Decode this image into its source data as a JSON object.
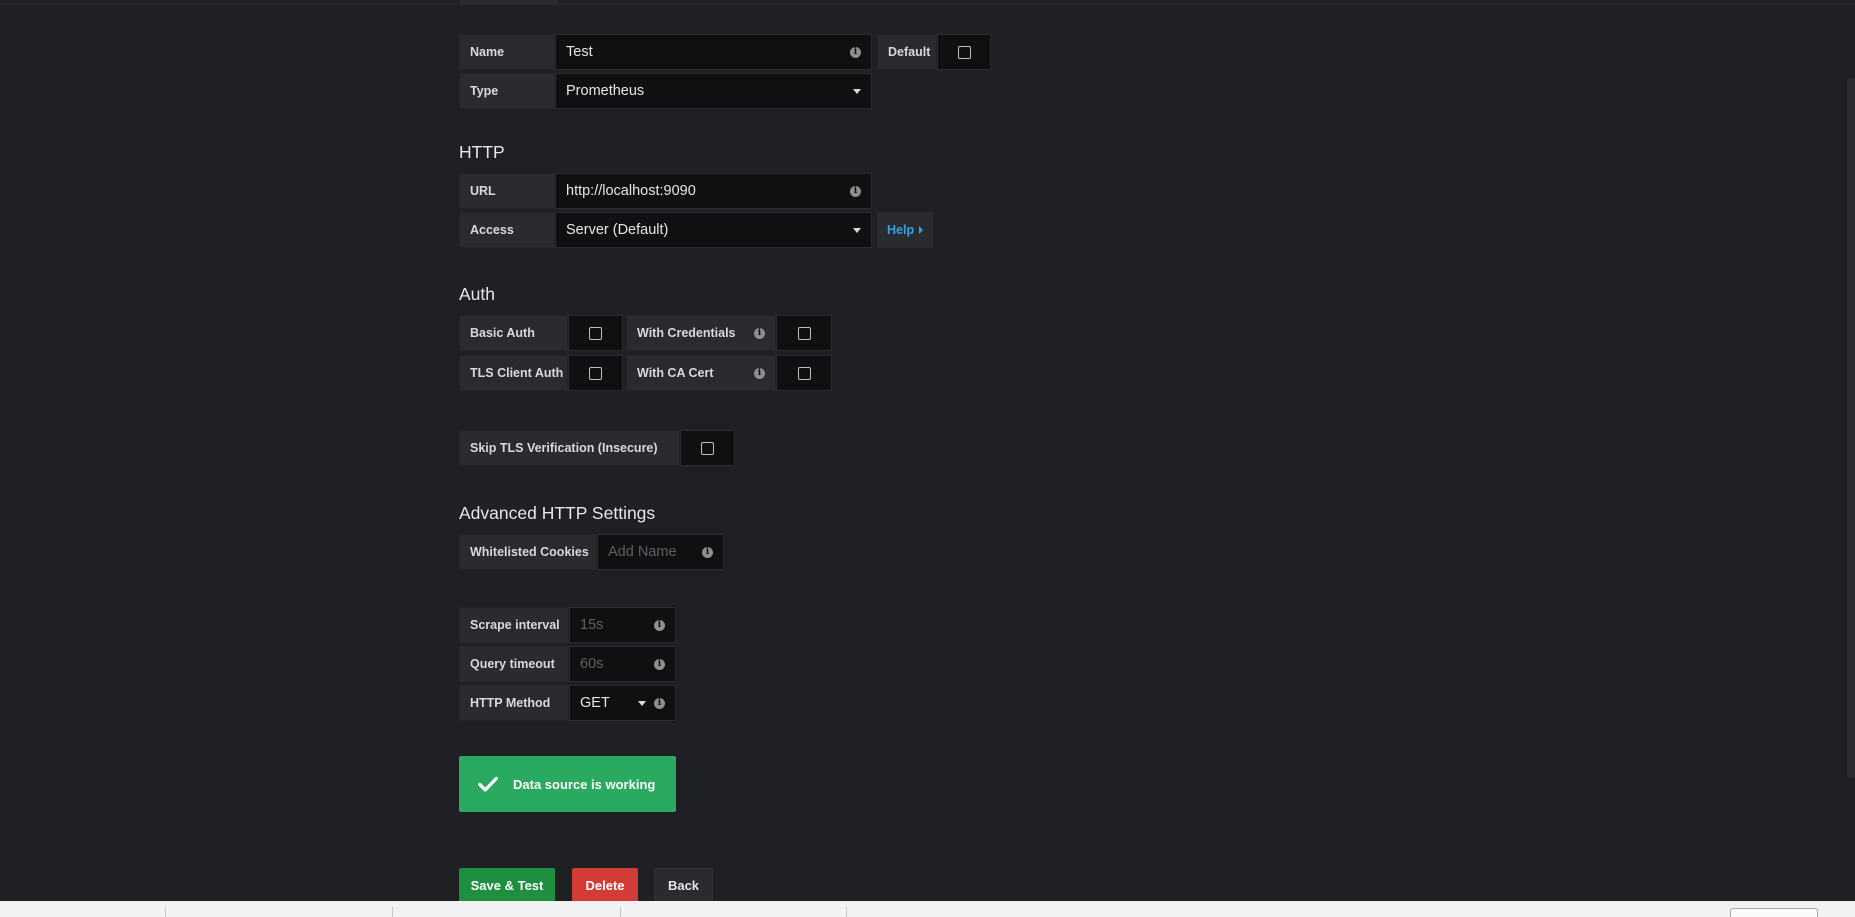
{
  "form": {
    "name_label": "Name",
    "name_value": "Test",
    "default_label": "Default",
    "type_label": "Type",
    "type_value": "Prometheus"
  },
  "http": {
    "title": "HTTP",
    "url_label": "URL",
    "url_value": "http://localhost:9090",
    "access_label": "Access",
    "access_value": "Server (Default)",
    "help_label": "Help"
  },
  "auth": {
    "title": "Auth",
    "basic_auth_label": "Basic Auth",
    "with_credentials_label": "With Credentials",
    "tls_client_auth_label": "TLS Client Auth",
    "with_ca_cert_label": "With CA Cert",
    "skip_tls_label": "Skip TLS Verification (Insecure)"
  },
  "advanced": {
    "title": "Advanced HTTP Settings",
    "whitelisted_cookies_label": "Whitelisted Cookies",
    "whitelisted_cookies_placeholder": "Add Name"
  },
  "prometheus": {
    "scrape_interval_label": "Scrape interval",
    "scrape_interval_placeholder": "15s",
    "query_timeout_label": "Query timeout",
    "query_timeout_placeholder": "60s",
    "http_method_label": "HTTP Method",
    "http_method_value": "GET"
  },
  "status": {
    "message": "Data source is working",
    "color": "#2aa960"
  },
  "actions": {
    "save_label": "Save & Test",
    "delete_label": "Delete",
    "back_label": "Back"
  },
  "icons": {
    "info": "info-icon",
    "caret": "caret-down-icon",
    "check": "check-icon"
  }
}
